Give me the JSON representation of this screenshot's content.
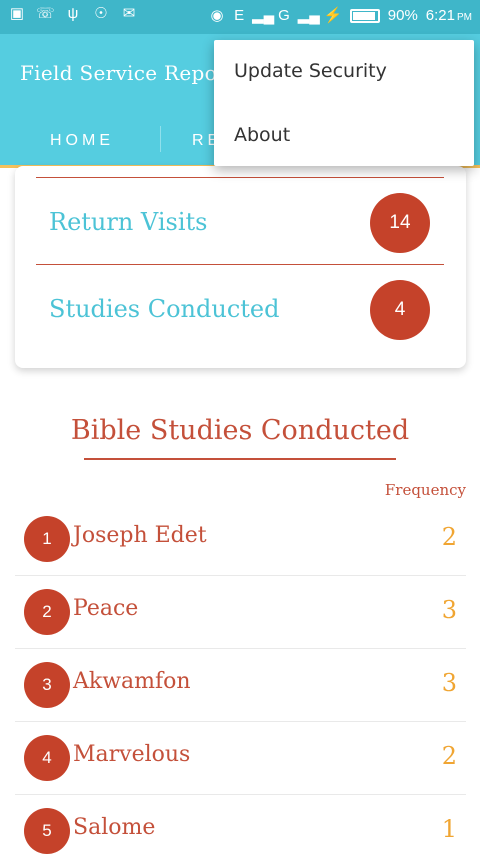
{
  "status_bar": {
    "battery": "90%",
    "time": "6:21",
    "ampm": "PM",
    "network": "E",
    "network2": "G"
  },
  "app": {
    "title": "Field Service Report"
  },
  "tabs": [
    {
      "label": "HOME"
    },
    {
      "label": "RE"
    }
  ],
  "summary": [
    {
      "label": "Return Visits",
      "value": "14"
    },
    {
      "label": "Studies Conducted",
      "value": "4"
    }
  ],
  "studies": {
    "title": "Bible Studies Conducted",
    "frequency_header": "Frequency",
    "rows": [
      {
        "index": "1",
        "name": "Joseph Edet",
        "frequency": "2"
      },
      {
        "index": "2",
        "name": "Peace",
        "frequency": "3"
      },
      {
        "index": "3",
        "name": "Akwamfon",
        "frequency": "3"
      },
      {
        "index": "4",
        "name": "Marvelous",
        "frequency": "2"
      },
      {
        "index": "5",
        "name": "Salome",
        "frequency": "1"
      }
    ]
  },
  "menu": {
    "items": [
      {
        "label": "Update Security"
      },
      {
        "label": "About"
      }
    ]
  },
  "colors": {
    "primary": "#55cde0",
    "status_bar": "#3fb6c9",
    "accent_red": "#c5422a",
    "frequency_orange": "#f0a532",
    "tab_indicator": "#f5c15c"
  }
}
